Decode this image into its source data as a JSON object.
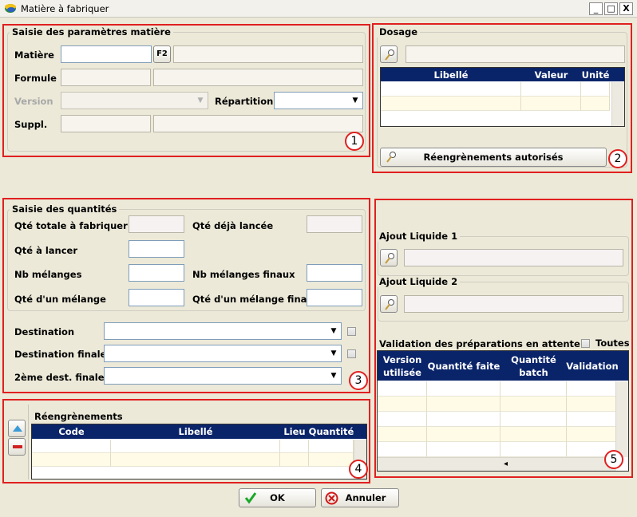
{
  "window": {
    "title": "Matière à fabriquer",
    "min_label": "_",
    "max_label": "□",
    "close_label": "X"
  },
  "params": {
    "group_title": "Saisie des paramètres matière",
    "matiere_label": "Matière",
    "f2_label": "F2",
    "formule_label": "Formule",
    "version_label": "Version",
    "repartition_label": "Répartition",
    "suppl_label": "Suppl.",
    "badge": "1"
  },
  "dosage": {
    "group_title": "Dosage",
    "columns": [
      "Libellé",
      "Valeur",
      "Unité"
    ],
    "reeng_button": "Réengrènements autorisés",
    "badge": "2"
  },
  "quantites": {
    "group_title": "Saisie des quantités",
    "qte_totale": "Qté totale à fabriquer",
    "qte_deja": "Qté déjà lancée",
    "qte_lancer": "Qté à lancer",
    "nb_melanges": "Nb mélanges",
    "nb_melanges_finaux": "Nb mélanges finaux",
    "qte_melange": "Qté d'un mélange",
    "qte_melange_final": "Qté d'un mélange final",
    "destination": "Destination",
    "destination_finale": "Destination finale",
    "dest2": "2ème dest. finale",
    "badge": "3"
  },
  "reengrenements": {
    "title": "Réengrènements",
    "columns": [
      "Code",
      "Libellé",
      "Lieu",
      "Quantité"
    ],
    "badge": "4"
  },
  "liquides": {
    "liquide1": "Ajout Liquide 1",
    "liquide2": "Ajout Liquide 2",
    "validation_title": "Validation des préparations en attente",
    "toutes_label": "Toutes",
    "columns": [
      "Version utilisée",
      "Quantité faite",
      "Quantité batch",
      "Validation"
    ],
    "scroll_left": "◂",
    "badge": "5"
  },
  "footer": {
    "ok_label": "OK",
    "cancel_label": "Annuler"
  }
}
